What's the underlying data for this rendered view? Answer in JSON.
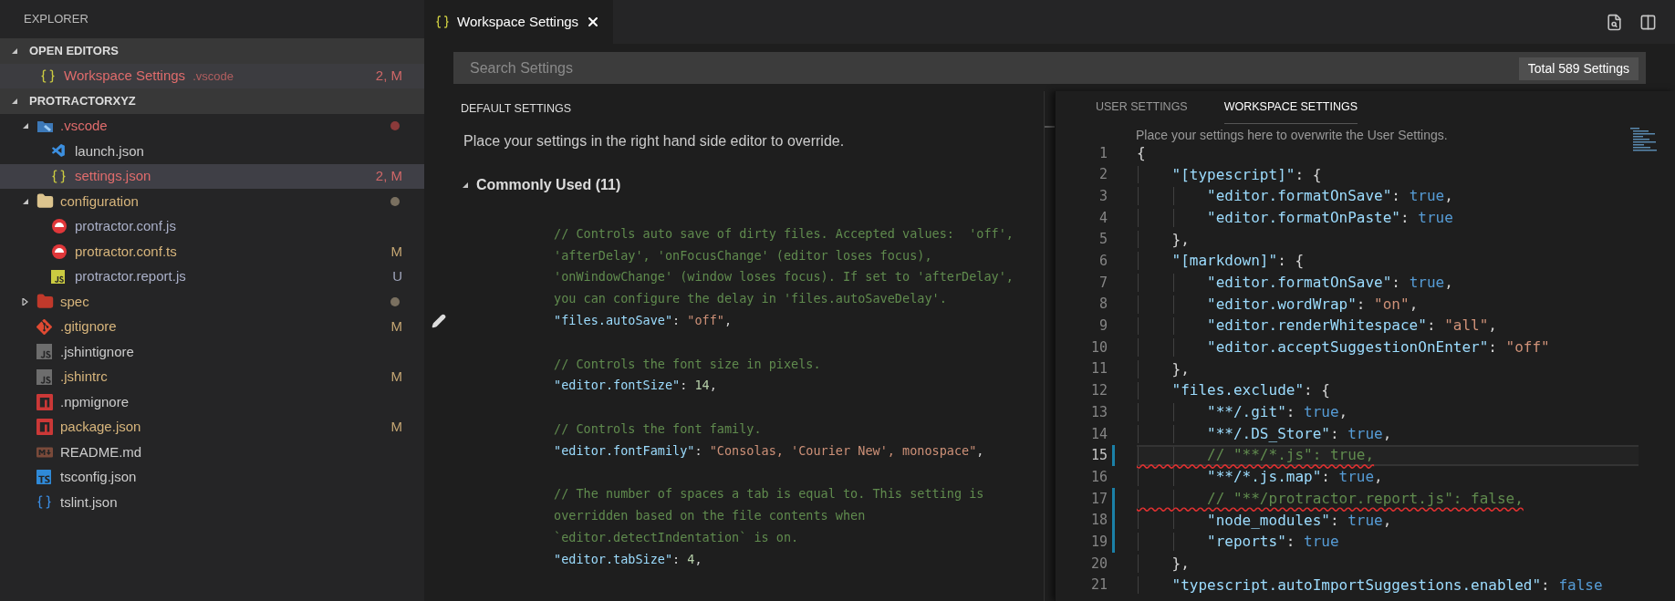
{
  "sidebar": {
    "title": "EXPLORER",
    "sections": [
      {
        "title": "OPEN EDITORS",
        "expanded": true,
        "items": [
          {
            "label": "Workspace Settings",
            "description": ".vscode",
            "badge": "2, M",
            "kind": "braces",
            "color": "#e06c6c",
            "selected": true
          }
        ]
      },
      {
        "title": "PROTRACTORXYZ",
        "expanded": true,
        "items": [
          {
            "label": ".vscode",
            "kind": "vscode-folder",
            "color": "#e06c6c",
            "dot": {
              "color": "#8b3a3a"
            },
            "expanded": true,
            "selected": false,
            "children": [
              {
                "label": "launch.json",
                "kind": "vscode",
                "color": "#cccccc",
                "selected": false
              },
              {
                "label": "settings.json",
                "kind": "braces",
                "color": "#e06c6c",
                "badge": "2, M",
                "selected": true
              }
            ]
          },
          {
            "label": "configuration",
            "kind": "folder",
            "color": "#d7b57c",
            "dot": {
              "color": "#7a7060"
            },
            "expanded": true,
            "selected": false,
            "children": [
              {
                "label": "protractor.conf.js",
                "kind": "protractor",
                "color": "#aab0c8",
                "selected": false
              },
              {
                "label": "protractor.conf.ts",
                "kind": "protractor",
                "color": "#d7b57c",
                "badge": "M",
                "selected": false
              },
              {
                "label": "protractor.report.js",
                "kind": "js",
                "color": "#aab0c8",
                "badge": "U",
                "selected": false
              }
            ]
          },
          {
            "label": "spec",
            "kind": "red-folder",
            "color": "#d7b57c",
            "dot": {
              "color": "#7a7060"
            },
            "expanded": false,
            "selected": false
          },
          {
            "label": ".gitignore",
            "kind": "git",
            "color": "#d7b57c",
            "badge": "M",
            "selected": false
          },
          {
            "label": ".jshintignore",
            "kind": "jshint",
            "color": "#cccccc",
            "selected": false
          },
          {
            "label": ".jshintrc",
            "kind": "jshint",
            "color": "#d7b57c",
            "badge": "M",
            "selected": false
          },
          {
            "label": ".npmignore",
            "kind": "npm",
            "color": "#cccccc",
            "selected": false
          },
          {
            "label": "package.json",
            "kind": "npm",
            "color": "#d7b57c",
            "badge": "M",
            "selected": false
          },
          {
            "label": "README.md",
            "kind": "markdown",
            "color": "#cccccc",
            "selected": false
          },
          {
            "label": "tsconfig.json",
            "kind": "tsconfig",
            "color": "#cccccc",
            "selected": false
          },
          {
            "label": "tslint.json",
            "kind": "tslint",
            "color": "#cccccc",
            "selected": false
          }
        ]
      }
    ]
  },
  "tab": {
    "label": "Workspace Settings",
    "selected": true
  },
  "search": {
    "placeholder": "Search Settings",
    "count": "Total 589 Settings"
  },
  "default_settings": {
    "title": "DEFAULT SETTINGS",
    "description": "Place your settings in the right hand side editor to override.",
    "group": {
      "title": "Commonly Used (11)",
      "expanded": true
    },
    "settings": [
      {
        "comment": [
          "// Controls auto save of dirty files. Accepted values:  'off',",
          "'afterDelay', 'onFocusChange' (editor loses focus),",
          "'onWindowChange' (window loses focus). If set to 'afterDelay',",
          "you can configure the delay in 'files.autoSaveDelay'."
        ],
        "edit_icon": true,
        "line": [
          {
            "kind": "key",
            "text": "\"files.autoSave\""
          },
          {
            "kind": "punct",
            "text": ": "
          },
          {
            "kind": "string",
            "text": "\"off\""
          },
          {
            "kind": "punct",
            "text": ","
          }
        ]
      },
      {
        "comment": [
          "// Controls the font size in pixels."
        ],
        "edit_icon": false,
        "line": [
          {
            "kind": "key",
            "text": "\"editor.fontSize\""
          },
          {
            "kind": "punct",
            "text": ": "
          },
          {
            "kind": "number",
            "text": "14"
          },
          {
            "kind": "punct",
            "text": ","
          }
        ]
      },
      {
        "comment": [
          "// Controls the font family."
        ],
        "edit_icon": false,
        "line": [
          {
            "kind": "key",
            "text": "\"editor.fontFamily\""
          },
          {
            "kind": "punct",
            "text": ": "
          },
          {
            "kind": "string",
            "text": "\"Consolas, 'Courier New', monospace\""
          },
          {
            "kind": "punct",
            "text": ","
          }
        ]
      },
      {
        "comment": [
          "// The number of spaces a tab is equal to. This setting is",
          "overridden based on the file contents when",
          "`editor.detectIndentation` is on."
        ],
        "edit_icon": false,
        "line": [
          {
            "kind": "key",
            "text": "\"editor.tabSize\""
          },
          {
            "kind": "punct",
            "text": ": "
          },
          {
            "kind": "number",
            "text": "4"
          },
          {
            "kind": "punct",
            "text": ","
          }
        ]
      }
    ]
  },
  "settings_editor": {
    "tabs": [
      {
        "label": "USER SETTINGS",
        "selected": false
      },
      {
        "label": "WORKSPACE SETTINGS",
        "selected": true
      }
    ],
    "note": "Place your settings here to overwrite the User Settings.",
    "lines": [
      {
        "number": "1",
        "modified": false,
        "error": false,
        "current": false,
        "tokens": [
          {
            "kind": "punct",
            "text": "{"
          }
        ]
      },
      {
        "number": "2",
        "modified": false,
        "error": false,
        "current": false,
        "tokens": [
          {
            "kind": "key",
            "text": "    \"[typescript]\""
          },
          {
            "kind": "punct",
            "text": ": {"
          }
        ]
      },
      {
        "number": "3",
        "modified": false,
        "error": false,
        "current": false,
        "tokens": [
          {
            "kind": "key",
            "text": "        \"editor.formatOnSave\""
          },
          {
            "kind": "punct",
            "text": ": "
          },
          {
            "kind": "bool",
            "text": "true"
          },
          {
            "kind": "punct",
            "text": ","
          }
        ]
      },
      {
        "number": "4",
        "modified": false,
        "error": false,
        "current": false,
        "tokens": [
          {
            "kind": "key",
            "text": "        \"editor.formatOnPaste\""
          },
          {
            "kind": "punct",
            "text": ": "
          },
          {
            "kind": "bool",
            "text": "true"
          }
        ]
      },
      {
        "number": "5",
        "modified": false,
        "error": false,
        "current": false,
        "tokens": [
          {
            "kind": "punct",
            "text": "    },"
          }
        ]
      },
      {
        "number": "6",
        "modified": false,
        "error": false,
        "current": false,
        "tokens": [
          {
            "kind": "key",
            "text": "    \"[markdown]\""
          },
          {
            "kind": "punct",
            "text": ": {"
          }
        ]
      },
      {
        "number": "7",
        "modified": false,
        "error": false,
        "current": false,
        "tokens": [
          {
            "kind": "key",
            "text": "        \"editor.formatOnSave\""
          },
          {
            "kind": "punct",
            "text": ": "
          },
          {
            "kind": "bool",
            "text": "true"
          },
          {
            "kind": "punct",
            "text": ","
          }
        ]
      },
      {
        "number": "8",
        "modified": false,
        "error": false,
        "current": false,
        "tokens": [
          {
            "kind": "key",
            "text": "        \"editor.wordWrap\""
          },
          {
            "kind": "punct",
            "text": ": "
          },
          {
            "kind": "string",
            "text": "\"on\""
          },
          {
            "kind": "punct",
            "text": ","
          }
        ]
      },
      {
        "number": "9",
        "modified": false,
        "error": false,
        "current": false,
        "tokens": [
          {
            "kind": "key",
            "text": "        \"editor.renderWhitespace\""
          },
          {
            "kind": "punct",
            "text": ": "
          },
          {
            "kind": "string",
            "text": "\"all\""
          },
          {
            "kind": "punct",
            "text": ","
          }
        ]
      },
      {
        "number": "10",
        "modified": false,
        "error": false,
        "current": false,
        "tokens": [
          {
            "kind": "key",
            "text": "        \"editor.acceptSuggestionOnEnter\""
          },
          {
            "kind": "punct",
            "text": ": "
          },
          {
            "kind": "string",
            "text": "\"off\""
          }
        ]
      },
      {
        "number": "11",
        "modified": false,
        "error": false,
        "current": false,
        "tokens": [
          {
            "kind": "punct",
            "text": "    },"
          }
        ]
      },
      {
        "number": "12",
        "modified": false,
        "error": false,
        "current": false,
        "tokens": [
          {
            "kind": "key",
            "text": "    \"files.exclude\""
          },
          {
            "kind": "punct",
            "text": ": {"
          }
        ]
      },
      {
        "number": "13",
        "modified": false,
        "error": false,
        "current": false,
        "tokens": [
          {
            "kind": "key",
            "text": "        \"**/.git\""
          },
          {
            "kind": "punct",
            "text": ": "
          },
          {
            "kind": "bool",
            "text": "true"
          },
          {
            "kind": "punct",
            "text": ","
          }
        ]
      },
      {
        "number": "14",
        "modified": false,
        "error": false,
        "current": false,
        "tokens": [
          {
            "kind": "key",
            "text": "        \"**/.DS_Store\""
          },
          {
            "kind": "punct",
            "text": ": "
          },
          {
            "kind": "bool",
            "text": "true"
          },
          {
            "kind": "punct",
            "text": ","
          }
        ]
      },
      {
        "number": "15",
        "modified": true,
        "error": true,
        "current": true,
        "tokens": [
          {
            "kind": "comment",
            "text": "        // \"**/*.js\": true,"
          }
        ]
      },
      {
        "number": "16",
        "modified": false,
        "error": false,
        "current": false,
        "tokens": [
          {
            "kind": "key",
            "text": "        \"**/*.js.map\""
          },
          {
            "kind": "punct",
            "text": ": "
          },
          {
            "kind": "bool",
            "text": "true"
          },
          {
            "kind": "punct",
            "text": ","
          }
        ]
      },
      {
        "number": "17",
        "modified": true,
        "error": true,
        "current": false,
        "tokens": [
          {
            "kind": "comment",
            "text": "        // \"**/protractor.report.js\": false,"
          }
        ]
      },
      {
        "number": "18",
        "modified": true,
        "error": false,
        "current": false,
        "tokens": [
          {
            "kind": "key",
            "text": "        \"node_modules\""
          },
          {
            "kind": "punct",
            "text": ": "
          },
          {
            "kind": "bool",
            "text": "true"
          },
          {
            "kind": "punct",
            "text": ","
          }
        ]
      },
      {
        "number": "19",
        "modified": true,
        "error": false,
        "current": false,
        "tokens": [
          {
            "kind": "key",
            "text": "        \"reports\""
          },
          {
            "kind": "punct",
            "text": ": "
          },
          {
            "kind": "bool",
            "text": "true"
          }
        ]
      },
      {
        "number": "20",
        "modified": false,
        "error": false,
        "current": false,
        "tokens": [
          {
            "kind": "punct",
            "text": "    },"
          }
        ]
      },
      {
        "number": "21",
        "modified": false,
        "error": false,
        "current": false,
        "tokens": [
          {
            "kind": "key",
            "text": "    \"typescript.autoImportSuggestions.enabled\""
          },
          {
            "kind": "punct",
            "text": ": "
          },
          {
            "kind": "bool",
            "text": "false"
          }
        ]
      }
    ]
  }
}
